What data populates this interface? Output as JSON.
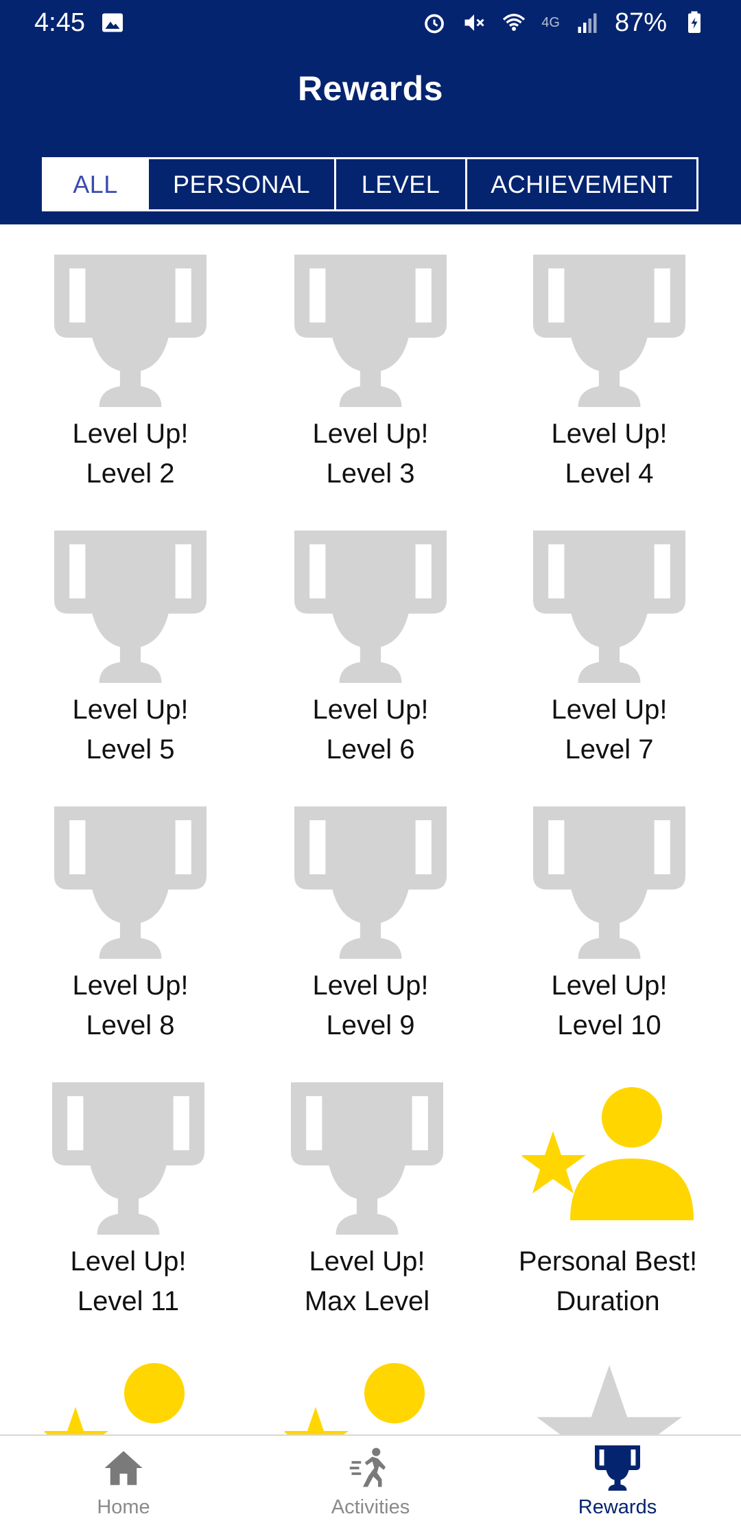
{
  "status": {
    "time": "4:45",
    "network": "4G",
    "battery": "87%"
  },
  "header": {
    "title": "Rewards"
  },
  "tabs": [
    {
      "label": "ALL",
      "active": true
    },
    {
      "label": "PERSONAL",
      "active": false
    },
    {
      "label": "LEVEL",
      "active": false
    },
    {
      "label": "ACHIEVEMENT",
      "active": false
    }
  ],
  "rewards": [
    {
      "line1": "Level Up!",
      "line2": "Level 2",
      "icon": "trophy-icon"
    },
    {
      "line1": "Level Up!",
      "line2": "Level 3",
      "icon": "trophy-icon"
    },
    {
      "line1": "Level Up!",
      "line2": "Level 4",
      "icon": "trophy-icon"
    },
    {
      "line1": "Level Up!",
      "line2": "Level 5",
      "icon": "trophy-icon"
    },
    {
      "line1": "Level Up!",
      "line2": "Level 6",
      "icon": "trophy-icon"
    },
    {
      "line1": "Level Up!",
      "line2": "Level 7",
      "icon": "trophy-icon"
    },
    {
      "line1": "Level Up!",
      "line2": "Level 8",
      "icon": "trophy-icon"
    },
    {
      "line1": "Level Up!",
      "line2": "Level 9",
      "icon": "trophy-icon"
    },
    {
      "line1": "Level Up!",
      "line2": "Level 10",
      "icon": "trophy-icon"
    },
    {
      "line1": "Level Up!",
      "line2": "Level 11",
      "icon": "trophy-icon"
    },
    {
      "line1": "Level Up!",
      "line2": "Max Level",
      "icon": "trophy-icon"
    },
    {
      "line1": "Personal Best!",
      "line2": "Duration",
      "icon": "person-star-icon"
    }
  ],
  "partial_row_icons": [
    "person-star-icon",
    "person-star-icon",
    "star-icon"
  ],
  "colors": {
    "header_bg": "#05246f",
    "trophy_gray": "#d3d3d3",
    "personal_yellow": "#ffd600",
    "active_tab_text": "#3a4bb0"
  },
  "nav": {
    "home": "Home",
    "activities": "Activities",
    "rewards": "Rewards"
  }
}
